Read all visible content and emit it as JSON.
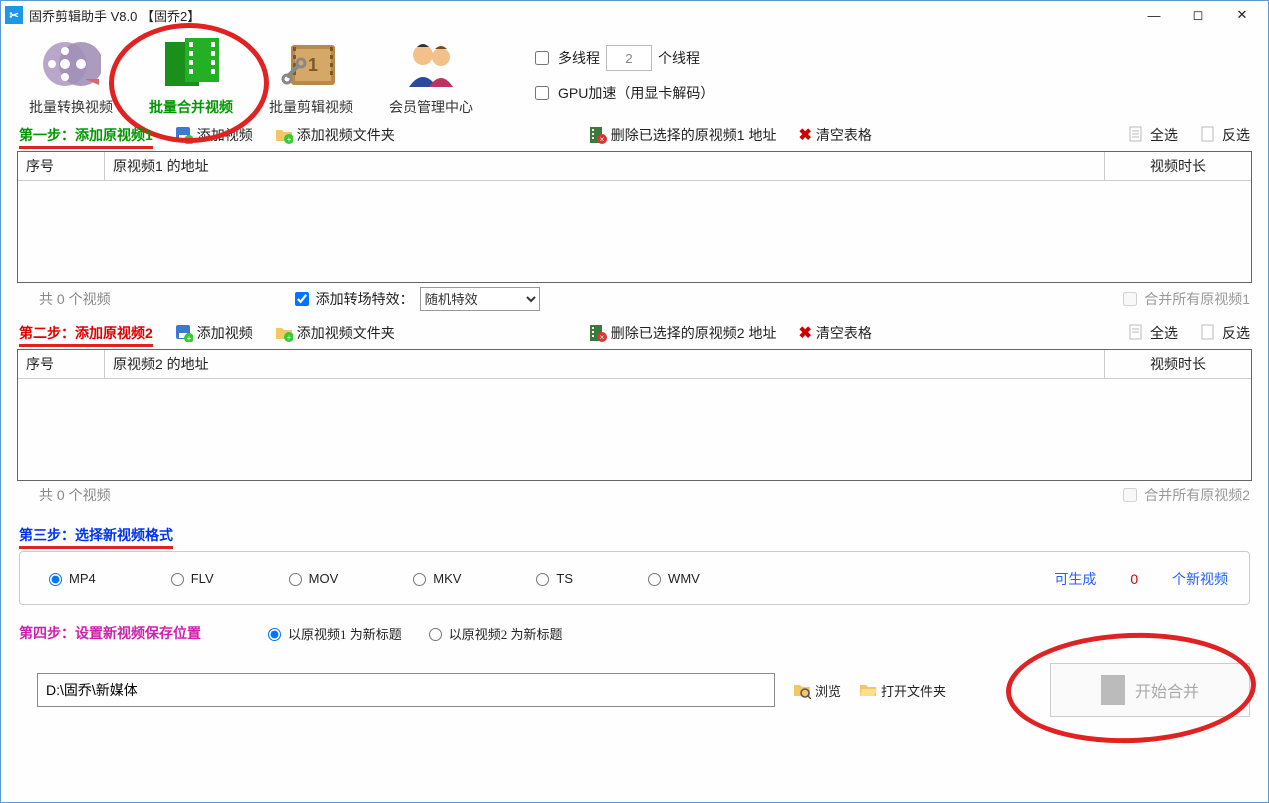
{
  "window": {
    "title": "固乔剪辑助手 V8.0  【固乔2】"
  },
  "toolbar": {
    "items": [
      {
        "label": "批量转换视频"
      },
      {
        "label": "批量合并视频"
      },
      {
        "label": "批量剪辑视频"
      },
      {
        "label": "会员管理中心"
      }
    ],
    "multithread_label": "多线程",
    "thread_value": "2",
    "thread_unit": "个线程",
    "gpu_label": "GPU加速（用显卡解码）"
  },
  "step1": {
    "label": "第一步：添加原视频1",
    "add_video": "添加视频",
    "add_folder": "添加视频文件夹",
    "delete_sel": "删除已选择的原视频1 地址",
    "clear": "清空表格",
    "select_all": "全选",
    "invert": "反选"
  },
  "table1": {
    "h1": "序号",
    "h2": "原视频1 的地址",
    "h3": "视频时长"
  },
  "foot1": {
    "count_text": "共 0 个视频",
    "transition_cb": "添加转场特效：",
    "transition_select": "随机特效",
    "merge_all": "合并所有原视频1"
  },
  "step2": {
    "label": "第二步：添加原视频2",
    "add_video": "添加视频",
    "add_folder": "添加视频文件夹",
    "delete_sel": "删除已选择的原视频2 地址",
    "clear": "清空表格",
    "select_all": "全选",
    "invert": "反选"
  },
  "table2": {
    "h1": "序号",
    "h2": "原视频2 的地址",
    "h3": "视频时长"
  },
  "foot2": {
    "count_text": "共 0 个视频",
    "merge_all": "合并所有原视频2"
  },
  "step3": {
    "label": "第三步：选择新视频格式",
    "formats": [
      "MP4",
      "FLV",
      "MOV",
      "MKV",
      "TS",
      "WMV"
    ],
    "gen_a": "可生成",
    "gen_n": "0",
    "gen_b": "个新视频"
  },
  "step4": {
    "label": "第四步：设置新视频保存位置",
    "opt1": "以原视频1 为新标题",
    "opt2": "以原视频2 为新标题",
    "path": "D:\\固乔\\新媒体",
    "browse": "浏览",
    "open_folder": "打开文件夹",
    "start": "开始合并"
  }
}
